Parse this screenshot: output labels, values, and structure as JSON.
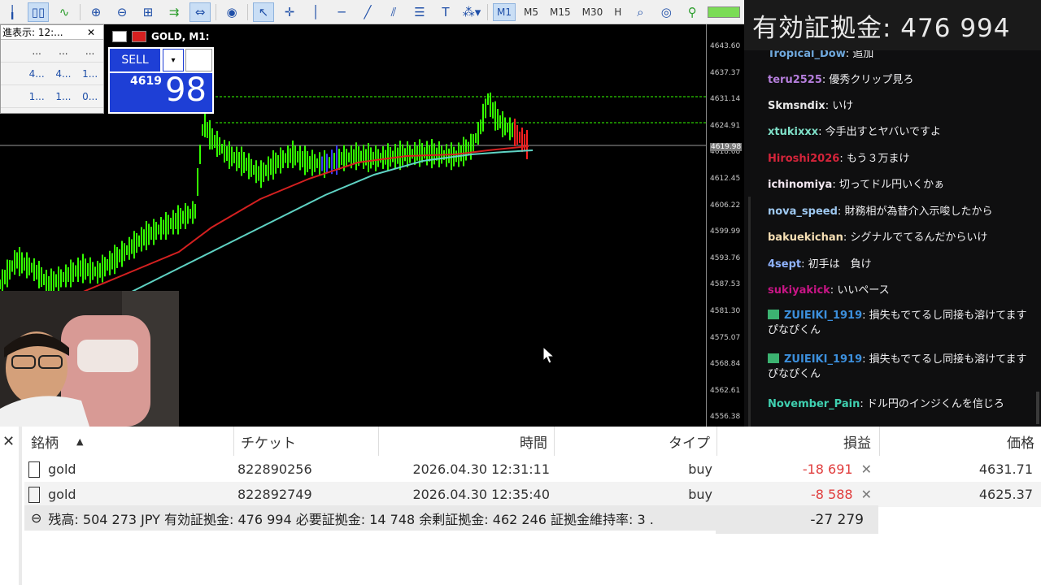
{
  "toolbar": {
    "icons": [
      "bar-chart-icon",
      "candle-chart-icon",
      "line-chart-icon",
      "zoom-in-icon",
      "zoom-out-icon",
      "grid-icon",
      "autoscroll-icon",
      "chart-shift-icon",
      "screenshot-icon",
      "cursor-icon",
      "crosshair-icon",
      "vertical-line-icon",
      "horizontal-line-icon",
      "trendline-icon",
      "channel-icon",
      "fibonacci-icon",
      "text-icon",
      "shapes-icon"
    ],
    "timeframes": [
      "M1",
      "M5",
      "M15",
      "M30",
      "H"
    ],
    "active_timeframe": "M1"
  },
  "margin_banner": "有効証拠金: 476 994",
  "market_watch": {
    "tab_title": "進表示: 12:...",
    "close": "✕",
    "rows": [
      [
        "...",
        "...",
        "..."
      ],
      [
        "4...",
        "4...",
        "1..."
      ],
      [
        "1...",
        "1...",
        "0..."
      ]
    ]
  },
  "chart": {
    "title": "GOLD, M1:",
    "sell_label": "SELL",
    "dropdown": "▾",
    "price_prefix": "4619",
    "price_suffix": "98",
    "price_labels": [
      "4643.60",
      "4637.37",
      "4631.14",
      "4624.91",
      "4618.68",
      "4612.45",
      "4606.22",
      "4599.99",
      "4593.76",
      "4587.53",
      "4581.30",
      "4575.07",
      "4568.84",
      "4562.61",
      "4556.38"
    ],
    "current_price": "4619.98",
    "colors": {
      "bg": "#000000",
      "candle": "#33ff00",
      "ma_red": "#d42020",
      "ma_cyan": "#5fd3c4",
      "level": "#33ff00"
    }
  },
  "chat": {
    "messages": [
      {
        "user": "Tropical_Dow",
        "color": "#6fa8dc",
        "text": "追加",
        "gift": false
      },
      {
        "user": "teru2525",
        "color": "#b57edc",
        "text": "優秀クリップ見ろ",
        "gift": false
      },
      {
        "user": "Skmsndix",
        "color": "#e8e8e8",
        "text": "いけ",
        "gift": false
      },
      {
        "user": "xtukixxx",
        "color": "#7fe0c8",
        "text": "今手出すとヤバいですよ",
        "gift": false
      },
      {
        "user": "Hiroshi2026",
        "color": "#d4243a",
        "text": "もう３万まけ",
        "gift": false
      },
      {
        "user": "ichinomiya",
        "color": "#f2e6f0",
        "text": "切ってドル円いくかぁ",
        "gift": false
      },
      {
        "user": "nova_speed",
        "color": "#9ec8f0",
        "text": "財務相が為替介入示唆したから",
        "gift": false
      },
      {
        "user": "bakuekichan",
        "color": "#f5deb3",
        "text": "シグナルでてるんだからいけ",
        "gift": false
      },
      {
        "user": "4sept",
        "color": "#8fb3ff",
        "text": "初手は　負け",
        "gift": false
      },
      {
        "user": "sukiyakick",
        "color": "#c71585",
        "text": "いいペース",
        "gift": false
      },
      {
        "user": "ZUIEIKI_1919",
        "color": "#3c8fdc",
        "text": "損失もでてるし同接も溶けてます　ぴなぴくん",
        "gift": true
      },
      {
        "user": "ZUIEIKI_1919",
        "color": "#3c8fdc",
        "text": "損失もでてるし同接も溶けてます　ぴなぴくん",
        "gift": true
      },
      {
        "user": "November_Pain",
        "color": "#3fd0b0",
        "text": "ドル円のインジくんを信じろ",
        "gift": false
      }
    ]
  },
  "trade_table": {
    "headers": {
      "symbol": "銘柄",
      "ticket": "チケット",
      "time": "時間",
      "type": "タイプ",
      "profit": "損益",
      "price": "価格"
    },
    "sort_indicator": "▲",
    "rows": [
      {
        "symbol": "gold",
        "ticket": "822890256",
        "time": "2026.04.30 12:31:11",
        "type": "buy",
        "profit": "-18 691",
        "price": "4631.71"
      },
      {
        "symbol": "gold",
        "ticket": "822892749",
        "time": "2026.04.30 12:35:40",
        "type": "buy",
        "profit": "-8 588",
        "price": "4625.37"
      }
    ],
    "summary": "残高: 504 273 JPY  有効証拠金: 476 994  必要証拠金: 14 748  余剰証拠金: 462 246  証拠金維持率: 3 .",
    "total": "-27 279",
    "close": "✕",
    "remove": "✕",
    "collapse": "⊖"
  }
}
